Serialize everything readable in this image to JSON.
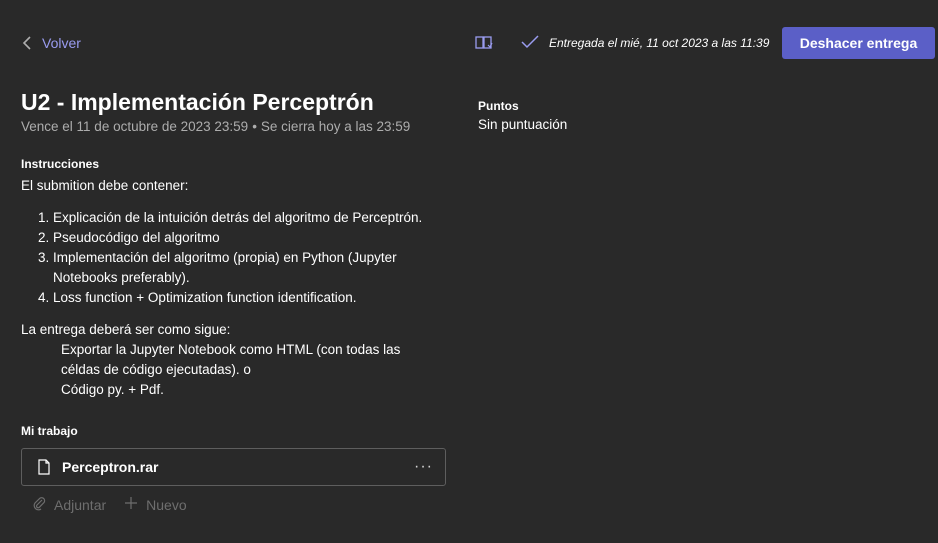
{
  "header": {
    "back_label": "Volver",
    "status_text": "Entregada el mié, 11 oct 2023 a las 11:39",
    "undo_label": "Deshacer entrega"
  },
  "assignment": {
    "title": "U2 - Implementación Perceptrón",
    "due_text": "Vence el 11 de octubre de 2023 23:59",
    "separator": "•",
    "close_text": "Se cierra hoy a las 23:59"
  },
  "instructions": {
    "heading": "Instrucciones",
    "intro": "El submition debe contener:",
    "items": [
      "Explicación de la intuición detrás del algoritmo de Perceptrón.",
      "Pseudocódigo del algoritmo",
      "Implementación del algoritmo (propia) en Python (Jupyter Notebooks preferably).",
      "Loss function + Optimization function identification."
    ],
    "delivery_intro": "La entrega deberá ser como sigue:",
    "delivery_lines": [
      "Exportar la Jupyter Notebook como HTML (con todas las céldas de código ejecutadas). o",
      "Código py. + Pdf."
    ]
  },
  "my_work": {
    "heading": "Mi trabajo",
    "file_name": "Perceptron.rar",
    "more_label": "···",
    "attach_label": "Adjuntar",
    "new_label": "Nuevo"
  },
  "points": {
    "label": "Puntos",
    "value": "Sin puntuación"
  },
  "icons": {
    "back": "chevron-left-icon",
    "reader": "immersive-reader-icon",
    "check": "checkmark-icon",
    "file": "document-icon",
    "attach": "paperclip-icon",
    "new": "plus-icon"
  },
  "colors": {
    "background": "#292929",
    "accent": "#5b5fc7",
    "link": "#9a9cf0",
    "muted": "#adadad",
    "disabled": "#6e6e6e"
  }
}
